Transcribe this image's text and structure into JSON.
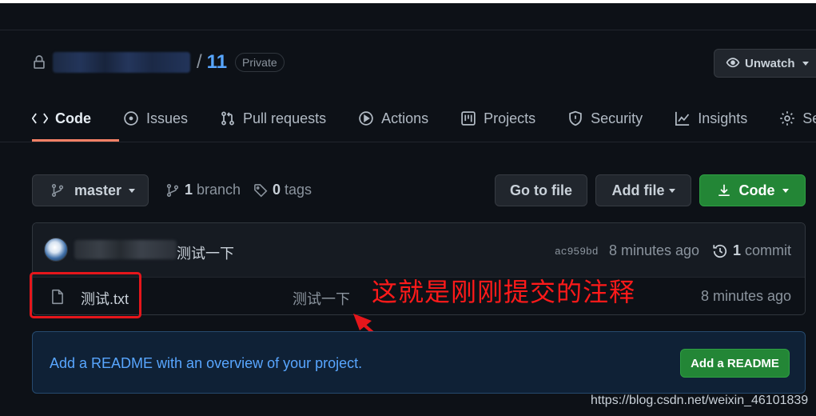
{
  "repo": {
    "separator": "/",
    "name": "11",
    "visibility": "Private",
    "watch_label": "Unwatch"
  },
  "tabs": [
    {
      "label": "Code",
      "icon": "code-icon",
      "active": true
    },
    {
      "label": "Issues",
      "icon": "issue-icon"
    },
    {
      "label": "Pull requests",
      "icon": "pull-request-icon"
    },
    {
      "label": "Actions",
      "icon": "play-icon"
    },
    {
      "label": "Projects",
      "icon": "project-icon"
    },
    {
      "label": "Security",
      "icon": "shield-icon"
    },
    {
      "label": "Insights",
      "icon": "graph-icon"
    },
    {
      "label": "Set",
      "icon": "gear-icon"
    }
  ],
  "toolbar": {
    "branch": "master",
    "branch_count": "1",
    "branch_word": "branch",
    "tag_count": "0",
    "tag_word": "tags",
    "goto_file": "Go to file",
    "add_file": "Add file",
    "code": "Code"
  },
  "latest_commit": {
    "message": "测试一下",
    "sha": "ac959bd",
    "time": "8 minutes ago",
    "commit_count": "1",
    "commit_word": "commit"
  },
  "files": [
    {
      "name": "测试.txt",
      "message": "测试一下",
      "time": "8 minutes ago",
      "icon": "file-icon"
    }
  ],
  "annotation": {
    "text": "这就是刚刚提交的注释",
    "color": "#ff1a1a"
  },
  "readme": {
    "text": "Add a README with an overview of your project.",
    "button": "Add a README"
  },
  "watermark": "https://blog.csdn.net/weixin_46101839",
  "colors": {
    "background": "#0d1117",
    "link": "#58a6ff",
    "primary_button": "#238636",
    "active_tab_underline": "#f78166"
  }
}
